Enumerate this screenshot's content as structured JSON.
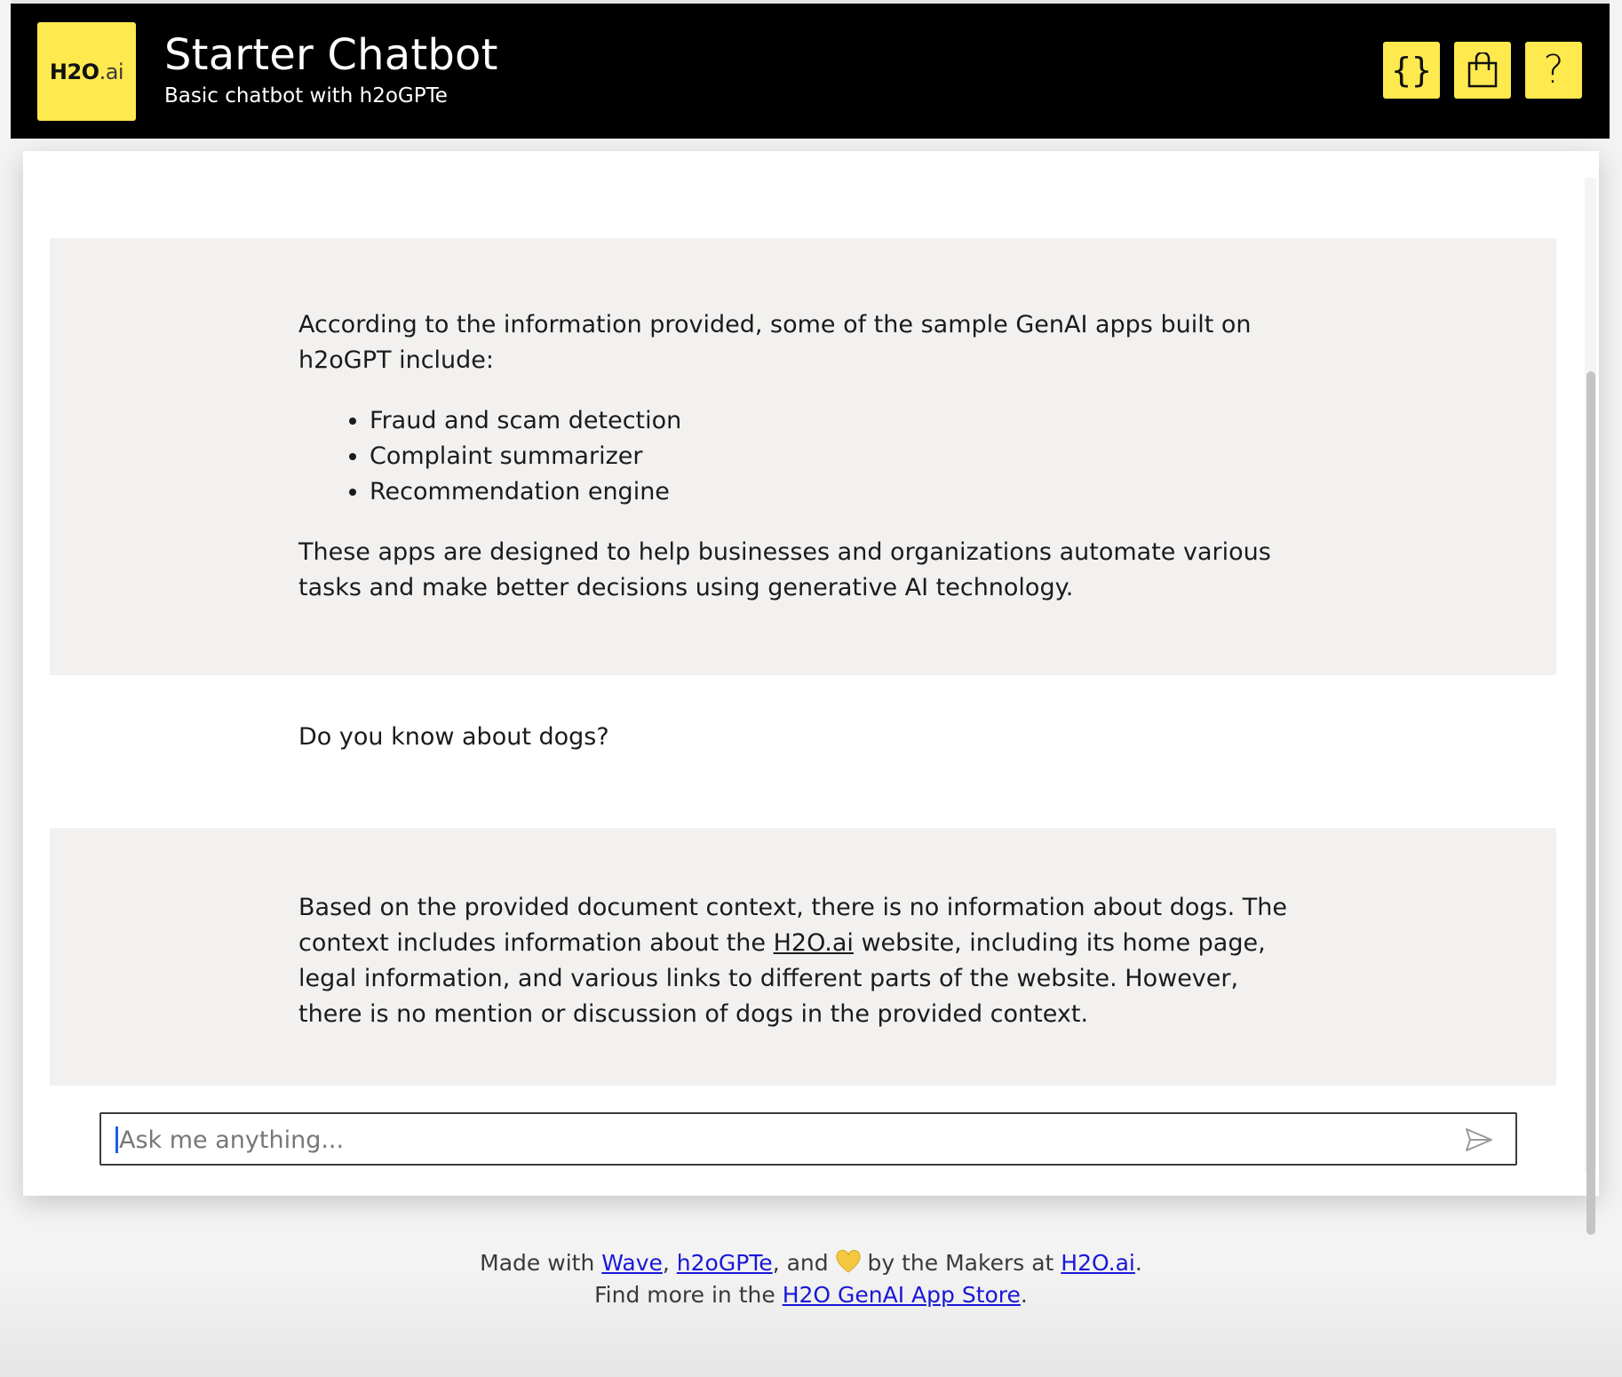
{
  "header": {
    "logo_main": "H2O",
    "logo_suffix": ".ai",
    "title": "Starter Chatbot",
    "subtitle": "Basic chatbot with h2oGPTe",
    "actions": [
      {
        "icon": "braces-icon",
        "glyph": "{}"
      },
      {
        "icon": "shopping-bag-icon"
      },
      {
        "icon": "help-icon",
        "glyph": "?"
      }
    ]
  },
  "chat": {
    "messages": [
      {
        "role": "bot",
        "intro": "According to the information provided, some of the sample GenAI apps built on h2oGPT include:",
        "items": [
          "Fraud and scam detection",
          "Complaint summarizer",
          "Recommendation engine"
        ],
        "outro": "These apps are designed to help businesses and organizations automate various tasks and make better decisions using generative AI technology."
      },
      {
        "role": "user",
        "text": "Do you know about dogs?"
      },
      {
        "role": "bot",
        "text_before_link": "Based on the provided document context, there is no information about dogs. The context includes information about the ",
        "link": "H2O.ai",
        "text_after_link": " website, including its home page, legal information, and various links to different parts of the website. However, there is no mention or discussion of dogs in the provided context."
      }
    ]
  },
  "input": {
    "placeholder": "Ask me anything...",
    "value": "",
    "send_icon": "send-icon"
  },
  "footer": {
    "line1_prefix": "Made with ",
    "wave_link": "Wave",
    "comma": ",",
    "h2ogpte_link": "h2oGPTe",
    "and_text": ", and ",
    "heart_icon": "yellow-heart-icon",
    "makers_text": " by the Makers at ",
    "h2oai_link": "H2O.ai",
    "period": ".",
    "line2_prefix": "Find more in the ",
    "store_link": "H2O GenAI App Store",
    "line2_suffix": "."
  },
  "colors": {
    "brand_yellow": "#fee94e",
    "header_bg": "#000000",
    "bot_message_bg": "#f2f1f0",
    "link_blue": "#1a17d6",
    "cursor_blue": "#1e5ee6"
  }
}
